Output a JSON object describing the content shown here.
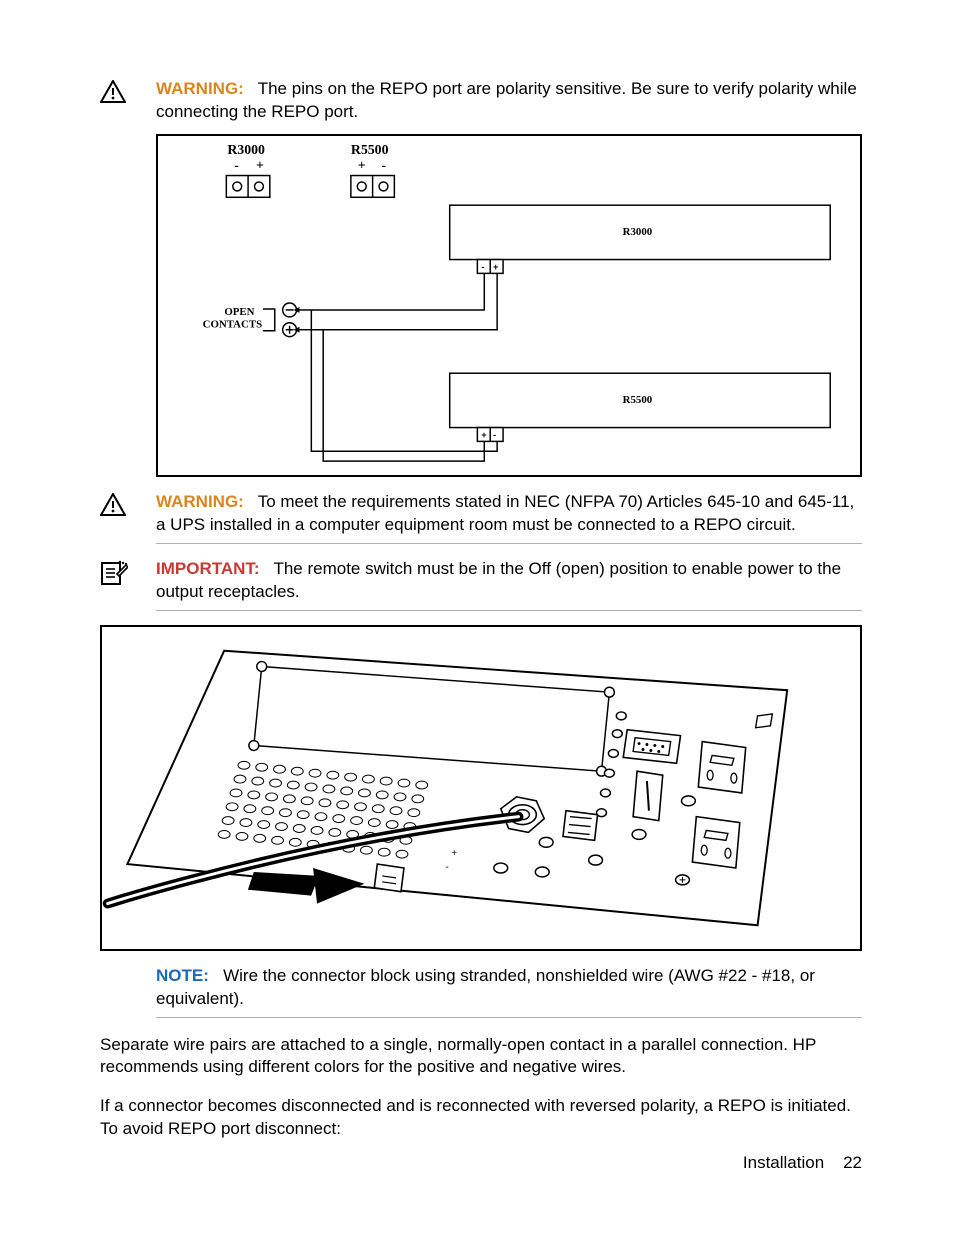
{
  "callouts": {
    "warning1": {
      "label": "WARNING:",
      "text": "The pins on the REPO port are polarity sensitive. Be sure to verify polarity while connecting the REPO port."
    },
    "warning2": {
      "label": "WARNING:",
      "text": "To meet the requirements stated in NEC (NFPA 70) Articles 645-10 and 645-11, a UPS installed in a computer equipment room must be connected to a REPO circuit."
    },
    "important1": {
      "label": "IMPORTANT:",
      "text": "The remote switch must be in the Off (open) position to enable power to the output receptacles."
    },
    "note1": {
      "label": "NOTE:",
      "text": "Wire the connector block using stranded, nonshielded wire (AWG #22 - #18, or equivalent)."
    }
  },
  "body": {
    "p1": "Separate wire pairs are attached to a single, normally-open contact in a parallel connection. HP recommends using different colors for the positive and negative wires.",
    "p2": "If a connector becomes disconnected and is reconnected with reversed polarity, a REPO is initiated. To avoid REPO port disconnect:"
  },
  "diagram1": {
    "label_r3000_top": "R3000",
    "label_r5500_top": "R5500",
    "minus": "-",
    "plus": "+",
    "label_r3000_box": "R3000",
    "label_r5500_box": "R5500",
    "open": "OPEN",
    "contacts": "CONTACTS"
  },
  "footer": {
    "section": "Installation",
    "page": "22"
  }
}
